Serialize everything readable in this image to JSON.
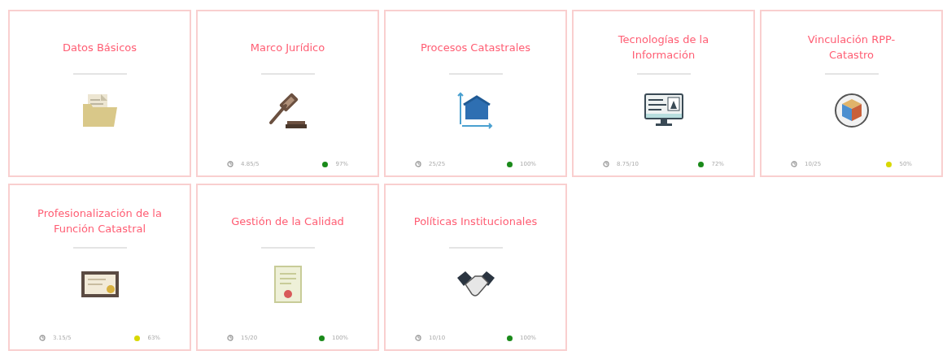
{
  "cards": [
    {
      "title": "Datos Básicos"
    },
    {
      "title": "Marco Jurídico",
      "score": "4.85/5",
      "percent": "97%",
      "color": "#1a8a1a"
    },
    {
      "title": "Procesos Catastrales",
      "score": "25/25",
      "percent": "100%",
      "color": "#1a8a1a"
    },
    {
      "title": "Tecnologías de la Información",
      "score": "8.75/10",
      "percent": "72%",
      "color": "#1a8a1a"
    },
    {
      "title": "Vinculación RPP-Catastro",
      "score": "10/25",
      "percent": "50%",
      "color": "#d8d800"
    },
    {
      "title": "Profesionalización de la Función Catastral",
      "score": "3.15/5",
      "percent": "63%",
      "color": "#d8d800"
    },
    {
      "title": "Gestión de la Calidad",
      "score": "15/20",
      "percent": "100%",
      "color": "#1a8a1a"
    },
    {
      "title": "Políticas Institucionales",
      "score": "10/10",
      "percent": "100%",
      "color": "#1a8a1a"
    }
  ]
}
